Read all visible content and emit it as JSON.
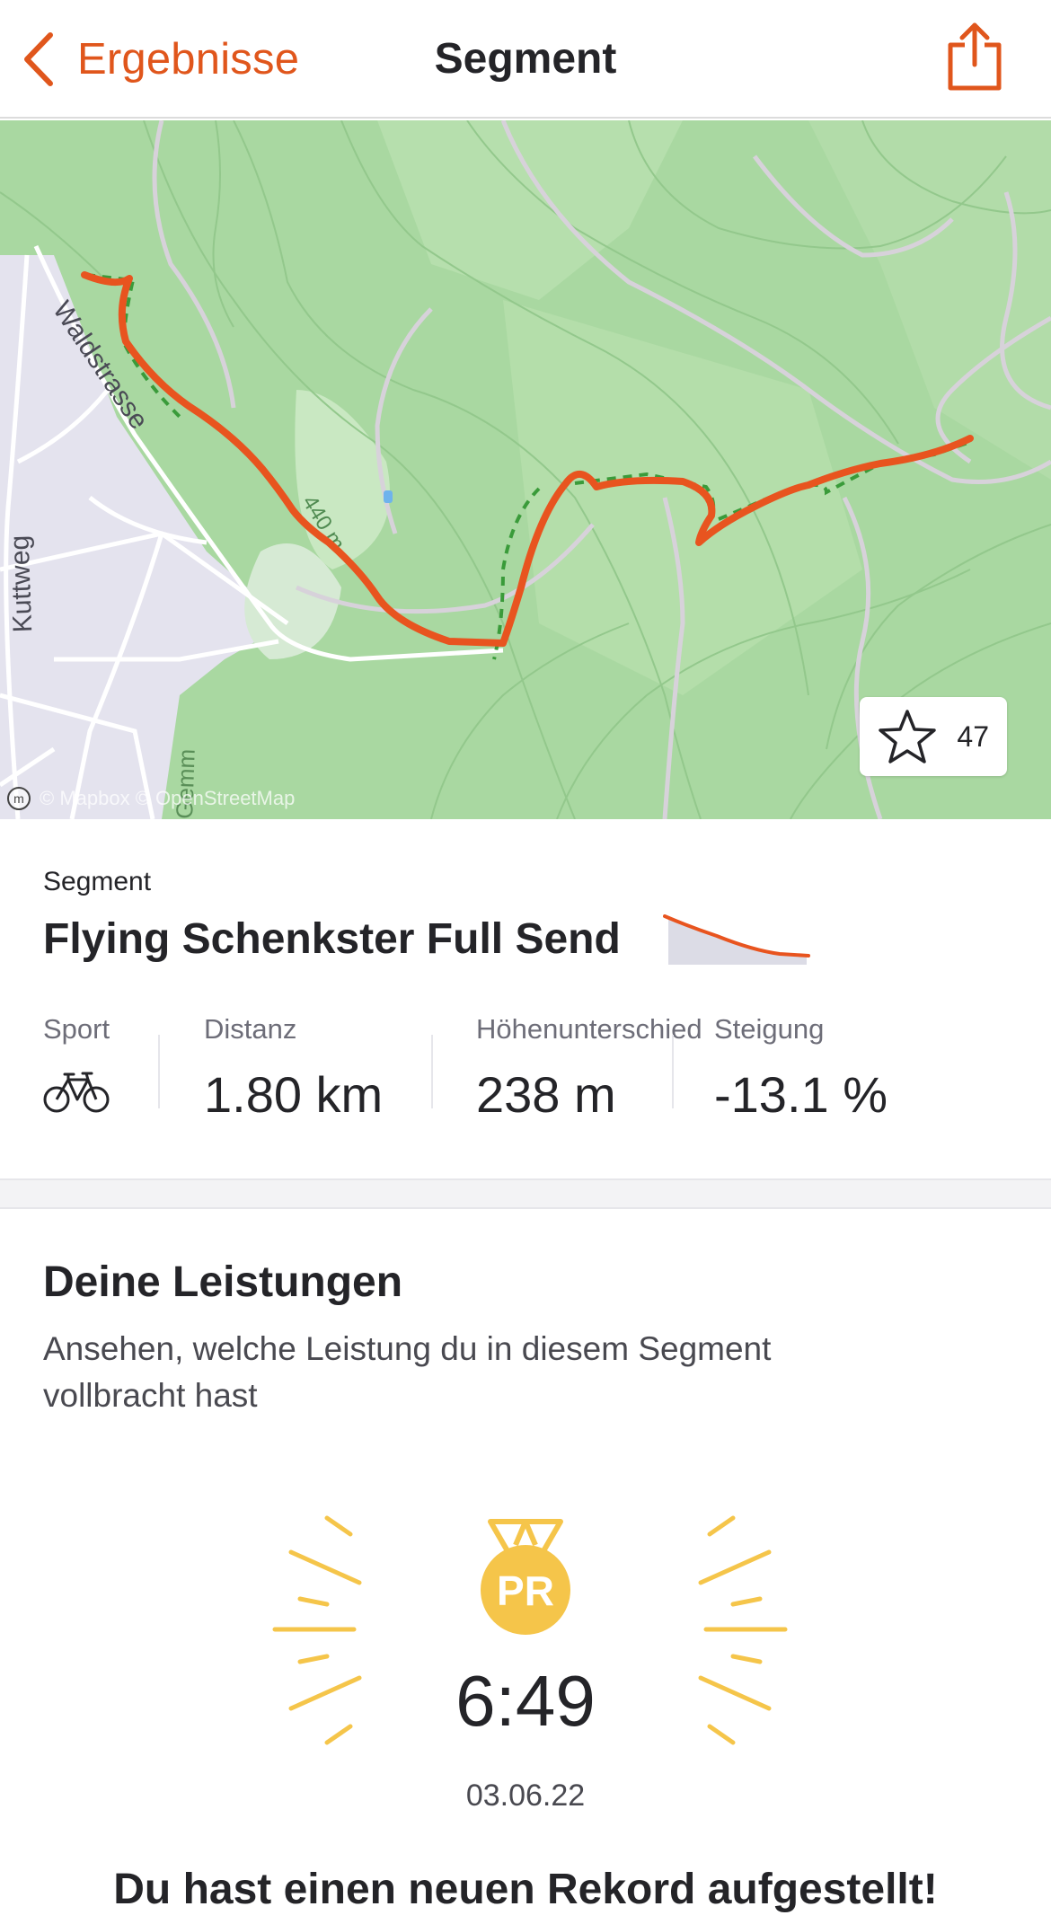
{
  "header": {
    "back_label": "Ergebnisse",
    "title": "Segment",
    "back_icon": "chevron-left-icon",
    "share_icon": "share-icon"
  },
  "map": {
    "street_label_1": "Waldstrasse",
    "street_label_2": "Kuttweg",
    "contour_label": "440 m",
    "street_label_3": "Gemm",
    "attribution": "© Mapbox © OpenStreetMap",
    "favorite_count": "47",
    "favorite_icon": "star-icon",
    "route_color": "#e8541f",
    "alt_route_color": "#3a9b3a"
  },
  "segment": {
    "label": "Segment",
    "name": "Flying Schenkster Full Send",
    "elevation_icon": "elevation-profile-icon"
  },
  "stats": {
    "sport_label": "Sport",
    "sport_icon": "bike-icon",
    "distance_label": "Distanz",
    "distance_value": "1.80 km",
    "elevation_label": "Höhenunterschied",
    "elevation_value": "238 m",
    "grade_label": "Steigung",
    "grade_value": "-13.1 %"
  },
  "performance": {
    "title": "Deine Leistungen",
    "subtitle": "Ansehen, welche Leistung du in diesem Segment vollbracht hast",
    "pr_badge": "PR",
    "time": "6:49",
    "date": "03.06.22",
    "record_text": "Du hast einen neuen Rekord aufgestellt!",
    "medal_color": "#f5c54a"
  },
  "colors": {
    "accent": "#e0561c",
    "text": "#242428"
  }
}
